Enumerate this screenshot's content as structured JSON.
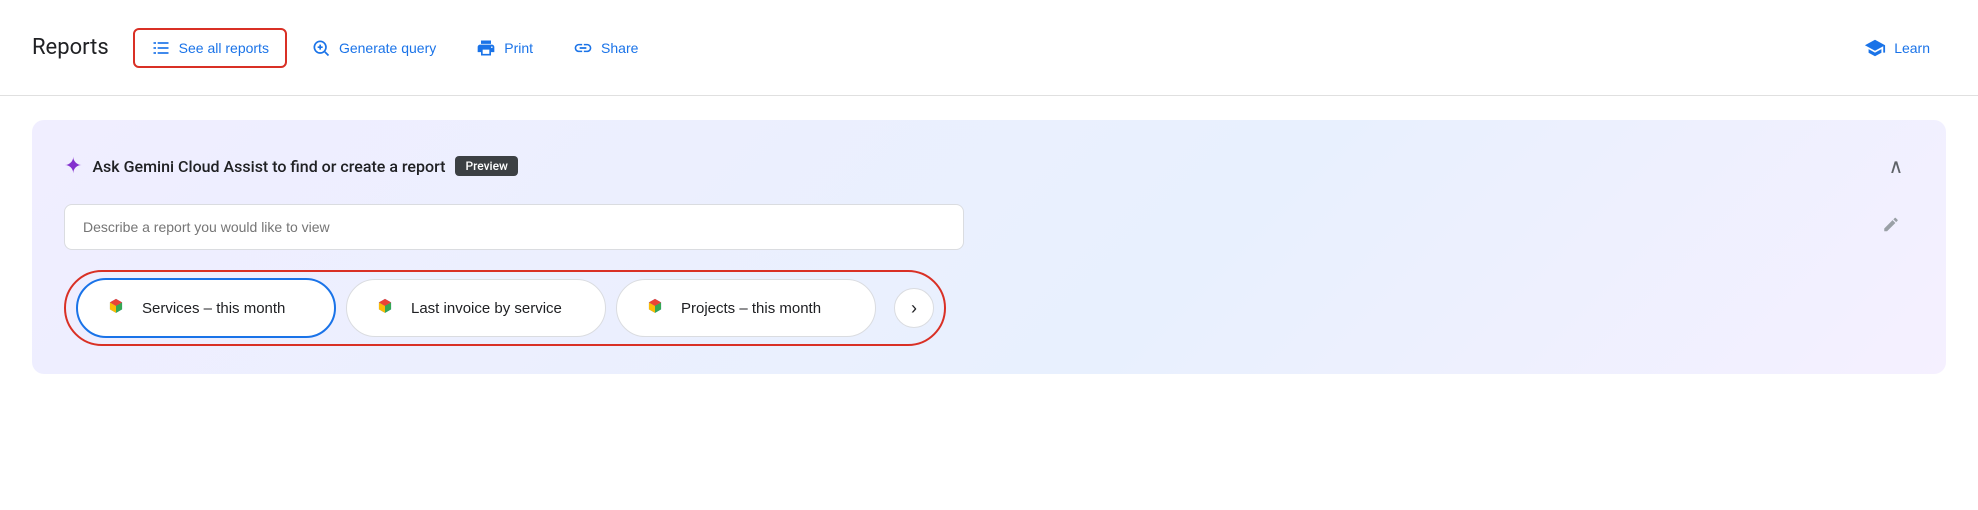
{
  "toolbar": {
    "title": "Reports",
    "buttons": [
      {
        "id": "see-all-reports",
        "label": "See all reports",
        "icon": "list-icon",
        "active": true
      },
      {
        "id": "generate-query",
        "label": "Generate query",
        "icon": "search-icon",
        "active": false
      },
      {
        "id": "print",
        "label": "Print",
        "icon": "print-icon",
        "active": false
      },
      {
        "id": "share",
        "label": "Share",
        "icon": "share-icon",
        "active": false
      }
    ],
    "learn_label": "Learn"
  },
  "gemini_card": {
    "title": "Ask Gemini Cloud Assist to find or create a report",
    "preview_badge": "Preview",
    "input_placeholder": "Describe a report you would like to view",
    "quick_buttons": [
      {
        "id": "services-this-month",
        "label": "Services – this month",
        "selected": true
      },
      {
        "id": "last-invoice",
        "label": "Last invoice by service",
        "selected": false
      },
      {
        "id": "projects-this-month",
        "label": "Projects – this month",
        "selected": false
      }
    ],
    "nav_arrow": "›"
  }
}
